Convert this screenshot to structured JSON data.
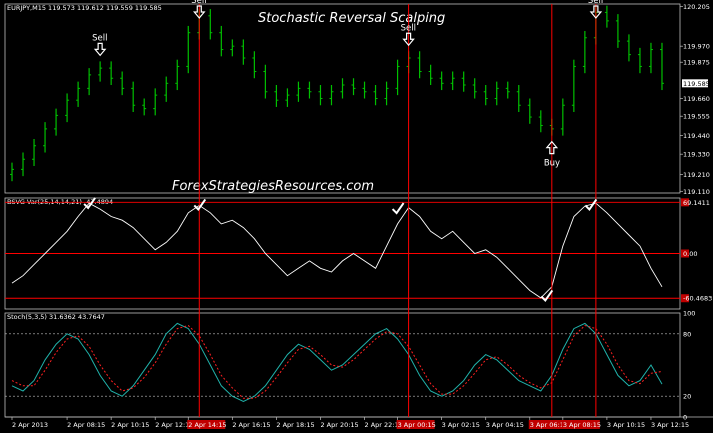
{
  "chart_title": "Stochastic Reversal Scalping",
  "watermark": "ForexStrategiesResources.com",
  "colors": {
    "background": "#000000",
    "frame": "#c0c0c0",
    "candle": "#00c000",
    "signal_line": "#ff0000",
    "oscillator": "#ffffff",
    "stoch_main": "#20b2aa",
    "stoch_signal": "#ff2020",
    "level_tag": "#c00000"
  },
  "signals": {
    "sell_label": "Sell",
    "buy_label": "Buy",
    "sell_at": [
      8,
      17,
      36,
      53
    ],
    "buy_at": [
      49
    ],
    "vertical_lines_at": [
      17,
      36,
      49,
      53
    ],
    "check_marks": [
      {
        "at": 7,
        "value": 67
      },
      {
        "at": 17,
        "value": 65
      },
      {
        "at": 35,
        "value": 60
      },
      {
        "at": 48.5,
        "value": -58
      },
      {
        "at": 52.5,
        "value": 65
      }
    ]
  },
  "chart_data": [
    {
      "type": "line",
      "panel": "price",
      "label": "EURJPY,M15  119.573 119.612 119.559 119.585",
      "ylim": [
        119.1,
        120.22
      ],
      "yticks": [
        "120.205",
        "119.970",
        "119.875",
        "119.660",
        "119.555",
        "119.440",
        "119.330",
        "119.210",
        "119.110"
      ],
      "ytick_values": [
        120.205,
        119.97,
        119.875,
        119.66,
        119.555,
        119.44,
        119.33,
        119.21,
        119.11
      ],
      "current_price": "119.585",
      "x": [
        0,
        1,
        2,
        3,
        4,
        5,
        6,
        7,
        8,
        9,
        10,
        11,
        12,
        13,
        14,
        15,
        16,
        17,
        18,
        19,
        20,
        21,
        22,
        23,
        24,
        25,
        26,
        27,
        28,
        29,
        30,
        31,
        32,
        33,
        34,
        35,
        36,
        37,
        38,
        39,
        40,
        41,
        42,
        43,
        44,
        45,
        46,
        47,
        48,
        49,
        50,
        51,
        52,
        53,
        54,
        55,
        56,
        57,
        58,
        59
      ],
      "y": [
        119.24,
        119.3,
        119.38,
        119.48,
        119.56,
        119.65,
        119.72,
        119.8,
        119.84,
        119.78,
        119.72,
        119.62,
        119.6,
        119.68,
        119.75,
        119.85,
        120.05,
        120.15,
        120.05,
        119.95,
        119.97,
        119.9,
        119.82,
        119.7,
        119.65,
        119.68,
        119.72,
        119.7,
        119.66,
        119.7,
        119.74,
        119.72,
        119.7,
        119.66,
        119.72,
        119.85,
        119.9,
        119.82,
        119.78,
        119.75,
        119.78,
        119.74,
        119.7,
        119.66,
        119.72,
        119.7,
        119.62,
        119.55,
        119.5,
        119.48,
        119.62,
        119.85,
        120.02,
        120.17,
        120.12,
        120.0,
        119.92,
        119.85,
        119.95,
        119.75
      ]
    },
    {
      "type": "line",
      "panel": "oscillator",
      "label": "BSVG-Var(25,14,14,21) -47.4894",
      "ylim": [
        -75,
        75
      ],
      "yticks": [
        "69.1411",
        "0.00",
        "-60.4683"
      ],
      "ytick_values": [
        69.1411,
        0,
        -60.4683
      ],
      "levels": [
        69.1411,
        0,
        -60.4683
      ],
      "x": [
        0,
        1,
        2,
        3,
        4,
        5,
        6,
        7,
        8,
        9,
        10,
        11,
        12,
        13,
        14,
        15,
        16,
        17,
        18,
        19,
        20,
        21,
        22,
        23,
        24,
        25,
        26,
        27,
        28,
        29,
        30,
        31,
        32,
        33,
        34,
        35,
        36,
        37,
        38,
        39,
        40,
        41,
        42,
        43,
        44,
        45,
        46,
        47,
        48,
        49,
        50,
        51,
        52,
        53,
        54,
        55,
        56,
        57,
        58,
        59
      ],
      "y": [
        -40,
        -30,
        -15,
        0,
        15,
        30,
        50,
        68,
        60,
        50,
        45,
        35,
        20,
        5,
        15,
        30,
        55,
        65,
        55,
        40,
        45,
        35,
        20,
        0,
        -15,
        -30,
        -20,
        -10,
        -20,
        -25,
        -10,
        0,
        -10,
        -20,
        10,
        40,
        62,
        50,
        30,
        20,
        30,
        15,
        0,
        5,
        -5,
        -20,
        -35,
        -50,
        -60,
        -45,
        10,
        50,
        64,
        68,
        55,
        40,
        25,
        10,
        -20,
        -45
      ]
    },
    {
      "type": "line",
      "panel": "stochastic",
      "label": "Stoch(5,3,5) 31.6362 43.7647",
      "ylim": [
        0,
        100
      ],
      "yticks": [
        "100",
        "80",
        "20",
        "0"
      ],
      "ytick_values": [
        100,
        80,
        20,
        0
      ],
      "levels": [
        80,
        20
      ],
      "series": [
        {
          "name": "31.6362",
          "y": [
            30,
            25,
            35,
            55,
            70,
            80,
            75,
            60,
            40,
            25,
            20,
            30,
            45,
            60,
            80,
            90,
            85,
            70,
            50,
            30,
            20,
            15,
            20,
            30,
            45,
            60,
            70,
            65,
            55,
            45,
            50,
            60,
            70,
            80,
            85,
            75,
            60,
            40,
            25,
            20,
            25,
            35,
            50,
            60,
            55,
            45,
            35,
            30,
            25,
            40,
            65,
            85,
            90,
            80,
            60,
            40,
            30,
            35,
            50,
            31.6
          ]
        },
        {
          "name": "43.7647",
          "y": [
            35,
            30,
            30,
            45,
            62,
            75,
            78,
            68,
            50,
            35,
            25,
            28,
            38,
            52,
            70,
            85,
            88,
            78,
            60,
            40,
            28,
            18,
            18,
            25,
            38,
            52,
            65,
            68,
            60,
            50,
            48,
            55,
            65,
            75,
            82,
            80,
            68,
            50,
            32,
            22,
            22,
            30,
            42,
            55,
            58,
            50,
            40,
            33,
            28,
            33,
            55,
            78,
            88,
            85,
            70,
            50,
            35,
            32,
            42,
            43.8
          ]
        }
      ]
    }
  ],
  "x_axis": {
    "labels": [
      "2 Apr 2013",
      "2 Apr 08:15",
      "2 Apr 10:15",
      "2 Apr 12:15",
      "2 Apr 14:15",
      "2 Apr 16:15",
      "2 Apr 18:15",
      "2 Apr 20:15",
      "2 Apr 22:15",
      "3 Apr 00:15",
      "3 Apr 02:15",
      "3 Apr 04:15",
      "3 Apr 06:15",
      "3 Apr 08:15",
      "3 Apr 10:15",
      "3 Apr 12:15"
    ],
    "label_at": [
      0,
      5,
      9,
      13,
      16,
      20,
      24,
      28,
      32,
      35,
      39,
      43,
      47,
      50,
      54,
      58
    ],
    "highlight_labels": [
      "2 Apr 14:15",
      "3 Apr 00:15",
      "3 Apr 06:15",
      "3 Apr 08:15"
    ]
  }
}
